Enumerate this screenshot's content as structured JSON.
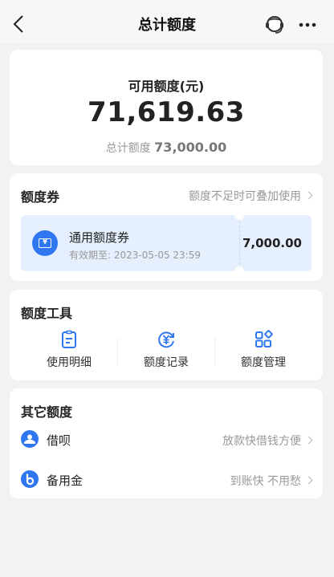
{
  "header": {
    "title": "总计额度"
  },
  "quota": {
    "label": "可用额度(元)",
    "amount": "71,619.63",
    "total_label": "总计额度",
    "total_value": "73,000.00"
  },
  "coupon_section": {
    "title": "额度券",
    "hint": "额度不足时可叠加使用",
    "coupon": {
      "icon_glyph": "¥",
      "name": "通用额度券",
      "validity": "有效期至: 2023-05-05 23:59",
      "amount": "7,000.00"
    }
  },
  "tools": {
    "title": "额度工具",
    "items": [
      {
        "label": "使用明细",
        "icon": "document-list-icon"
      },
      {
        "label": "额度记录",
        "icon": "yen-refresh-icon"
      },
      {
        "label": "额度管理",
        "icon": "grid-manage-icon"
      }
    ]
  },
  "other": {
    "title": "其它额度",
    "items": [
      {
        "label": "借呗",
        "hint": "放款快借钱方便",
        "icon": "jiebei-icon"
      },
      {
        "label": "备用金",
        "hint": "到账快 不用愁",
        "icon": "beiyongjin-icon"
      }
    ]
  },
  "colors": {
    "accent": "#2f77f1",
    "coupon_bg": "#e5effd",
    "page_bg": "#f2f2f3"
  }
}
